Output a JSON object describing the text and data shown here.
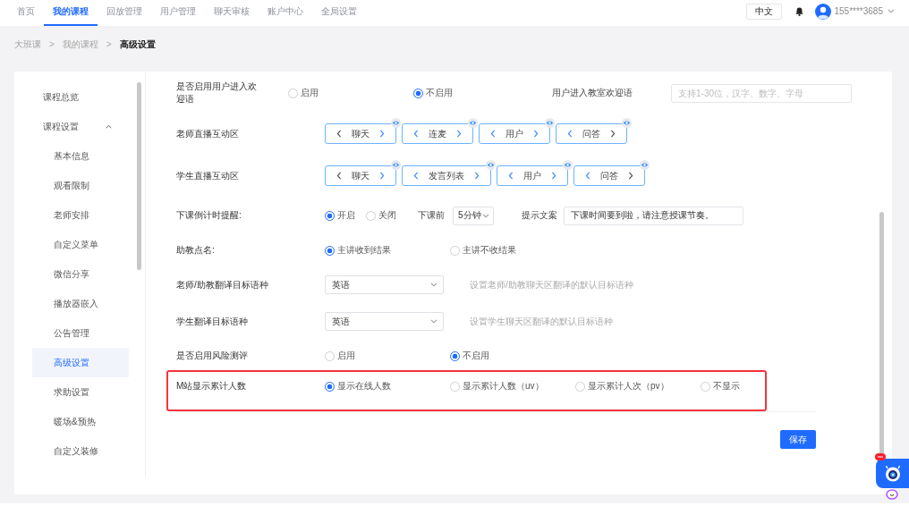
{
  "nav": {
    "items": [
      {
        "label": "首页",
        "selected": false
      },
      {
        "label": "我的课程",
        "selected": true
      },
      {
        "label": "回放管理",
        "selected": false
      },
      {
        "label": "用户管理",
        "selected": false
      },
      {
        "label": "聊天审核",
        "selected": false
      },
      {
        "label": "账户中心",
        "selected": false
      },
      {
        "label": "全局设置",
        "selected": false
      }
    ],
    "language": "中文",
    "user": "155****3685"
  },
  "breadcrumb": [
    {
      "label": "大班课",
      "current": false,
      "separator": ">"
    },
    {
      "label": "我的课程",
      "current": false,
      "separator": ">"
    },
    {
      "label": "高级设置",
      "current": true
    }
  ],
  "sidebar": {
    "items": [
      {
        "label": "课程总览",
        "selected": false
      },
      {
        "label": "课程设置",
        "selected": false,
        "expanded": true,
        "children": [
          {
            "label": "基本信息",
            "selected": false
          },
          {
            "label": "观看限制",
            "selected": false
          },
          {
            "label": "老师安排",
            "selected": false
          },
          {
            "label": "自定义菜单",
            "selected": false
          },
          {
            "label": "微信分享",
            "selected": false
          },
          {
            "label": "播放器嵌入",
            "selected": false
          },
          {
            "label": "公告管理",
            "selected": false
          },
          {
            "label": "高级设置",
            "selected": true
          },
          {
            "label": "求助设置",
            "selected": false
          },
          {
            "label": "暖场&预热",
            "selected": false
          },
          {
            "label": "自定义装修",
            "selected": false
          }
        ]
      }
    ]
  },
  "form": {
    "rows": [
      {
        "kind": "radio_input",
        "label": "是否启用用户进入欢迎语",
        "highlighted": false,
        "options": [
          {
            "label": "启用",
            "selected": false
          },
          {
            "label": "不启用",
            "selected": true
          }
        ],
        "field_label": "用户进入教室欢迎语",
        "field": {
          "placeholder": "支持1-30位，汉字、数字、字母"
        }
      },
      {
        "kind": "tabs",
        "label": "老师直播互动区",
        "highlighted": false,
        "tabs": [
          {
            "label": "聊天",
            "left_enabled": false,
            "right_enabled": true
          },
          {
            "label": "连麦",
            "left_enabled": true,
            "right_enabled": true
          },
          {
            "label": "用户",
            "left_enabled": true,
            "right_enabled": true
          },
          {
            "label": "问答",
            "left_enabled": true,
            "right_enabled": false
          }
        ]
      },
      {
        "kind": "tabs",
        "label": "学生直播互动区",
        "highlighted": false,
        "tabs": [
          {
            "label": "聊天",
            "left_enabled": false,
            "right_enabled": true
          },
          {
            "label": "发言列表",
            "left_enabled": true,
            "right_enabled": true
          },
          {
            "label": "用户",
            "left_enabled": true,
            "right_enabled": true
          },
          {
            "label": "问答",
            "left_enabled": true,
            "right_enabled": false
          }
        ]
      },
      {
        "kind": "radio_extra",
        "label": "下课倒计时提醒:",
        "highlighted": false,
        "options": [
          {
            "label": "开启",
            "selected": true
          },
          {
            "label": "关闭",
            "selected": false
          }
        ],
        "select_label": "下课前",
        "select": {
          "value": "5分钟"
        },
        "field_label": "提示文案",
        "field": {
          "value": "下课时间要到啦，请注意授课节奏。"
        }
      },
      {
        "kind": "radio",
        "label": "助教点名:",
        "highlighted": false,
        "options": [
          {
            "label": "主讲收到结果",
            "selected": true
          },
          {
            "label": "主讲不收结果",
            "selected": false
          }
        ]
      },
      {
        "kind": "select",
        "label": "老师/助教翻译目标语种",
        "highlighted": false,
        "select": {
          "value": "英语"
        },
        "hint": "设置老师/助教聊天区翻译的默认目标语种"
      },
      {
        "kind": "select",
        "label": "学生翻译目标语种",
        "highlighted": false,
        "select": {
          "value": "英语"
        },
        "hint": "设置学生聊天区翻译的默认目标语种"
      },
      {
        "kind": "radio",
        "label": "是否启用风险测评",
        "highlighted": false,
        "options": [
          {
            "label": "启用",
            "selected": false
          },
          {
            "label": "不启用",
            "selected": true
          }
        ]
      },
      {
        "kind": "radio",
        "label": "M站显示累计人数",
        "highlighted": true,
        "options": [
          {
            "label": "显示在线人数",
            "selected": true
          },
          {
            "label": "显示累计人数（uv）",
            "selected": false
          },
          {
            "label": "显示累计人次（pv）",
            "selected": false
          },
          {
            "label": "不显示",
            "selected": false
          }
        ]
      }
    ],
    "save_button": "保存"
  }
}
